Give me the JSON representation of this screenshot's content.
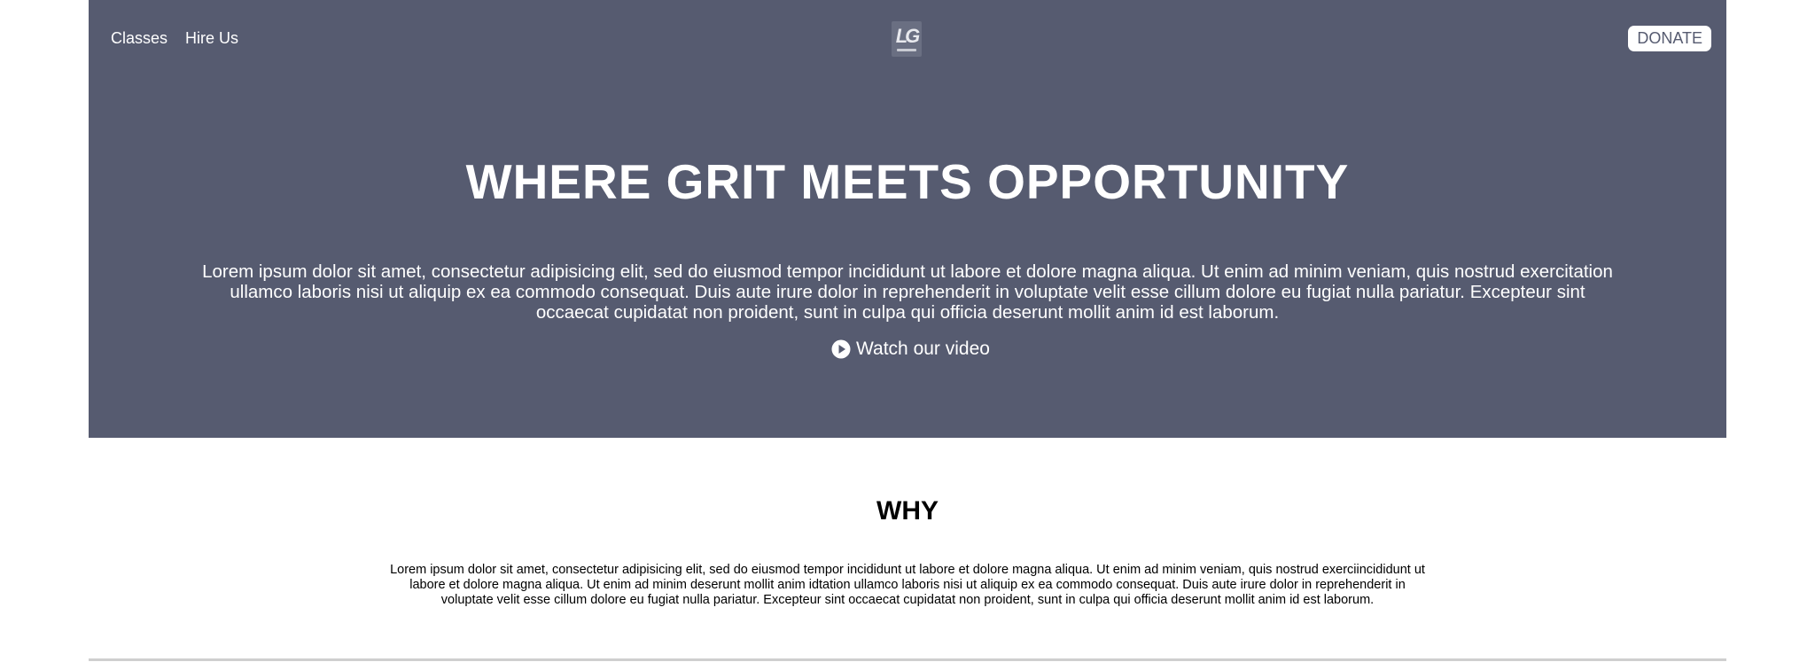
{
  "nav": {
    "links": [
      "Classes",
      "Hire Us"
    ],
    "logo_text": "LG",
    "donate_label": "DONATE"
  },
  "hero": {
    "headline": "WHERE GRIT MEETS OPPORTUNITY",
    "body": "Lorem ipsum dolor sit amet, consectetur adipisicing elit, sed do eiusmod tempor incididunt ut labore et dolore magna aliqua. Ut enim ad minim veniam, quis nostrud exercitation ullamco laboris nisi ut aliquip ex ea commodo consequat. Duis aute irure dolor in reprehenderit in voluptate velit esse cillum dolore eu fugiat nulla pariatur. Excepteur sint occaecat cupidatat non proident, sunt in culpa qui officia deserunt mollit anim id est laborum.",
    "video_link": "Watch our video",
    "video_icon": "play-circle-icon",
    "background_color": "#565b70"
  },
  "why": {
    "title": "WHY",
    "body": "Lorem ipsum dolor sit amet, consectetur adipisicing elit, sed do eiusmod tempor incididunt ut labore et dolore magna aliqua. Ut enim ad minim veniam, quis nostrud exerciincididunt ut labore et dolore magna aliqua. Ut enim ad minim deserunt mollit anim idtation ullamco laboris nisi ut aliquip ex ea commodo consequat. Duis aute irure dolor in reprehenderit in voluptate velit esse cillum dolore eu fugiat nulla pariatur. Excepteur sint occaecat cupidatat non proident, sunt in culpa qui officia deserunt mollit anim id est laborum."
  }
}
